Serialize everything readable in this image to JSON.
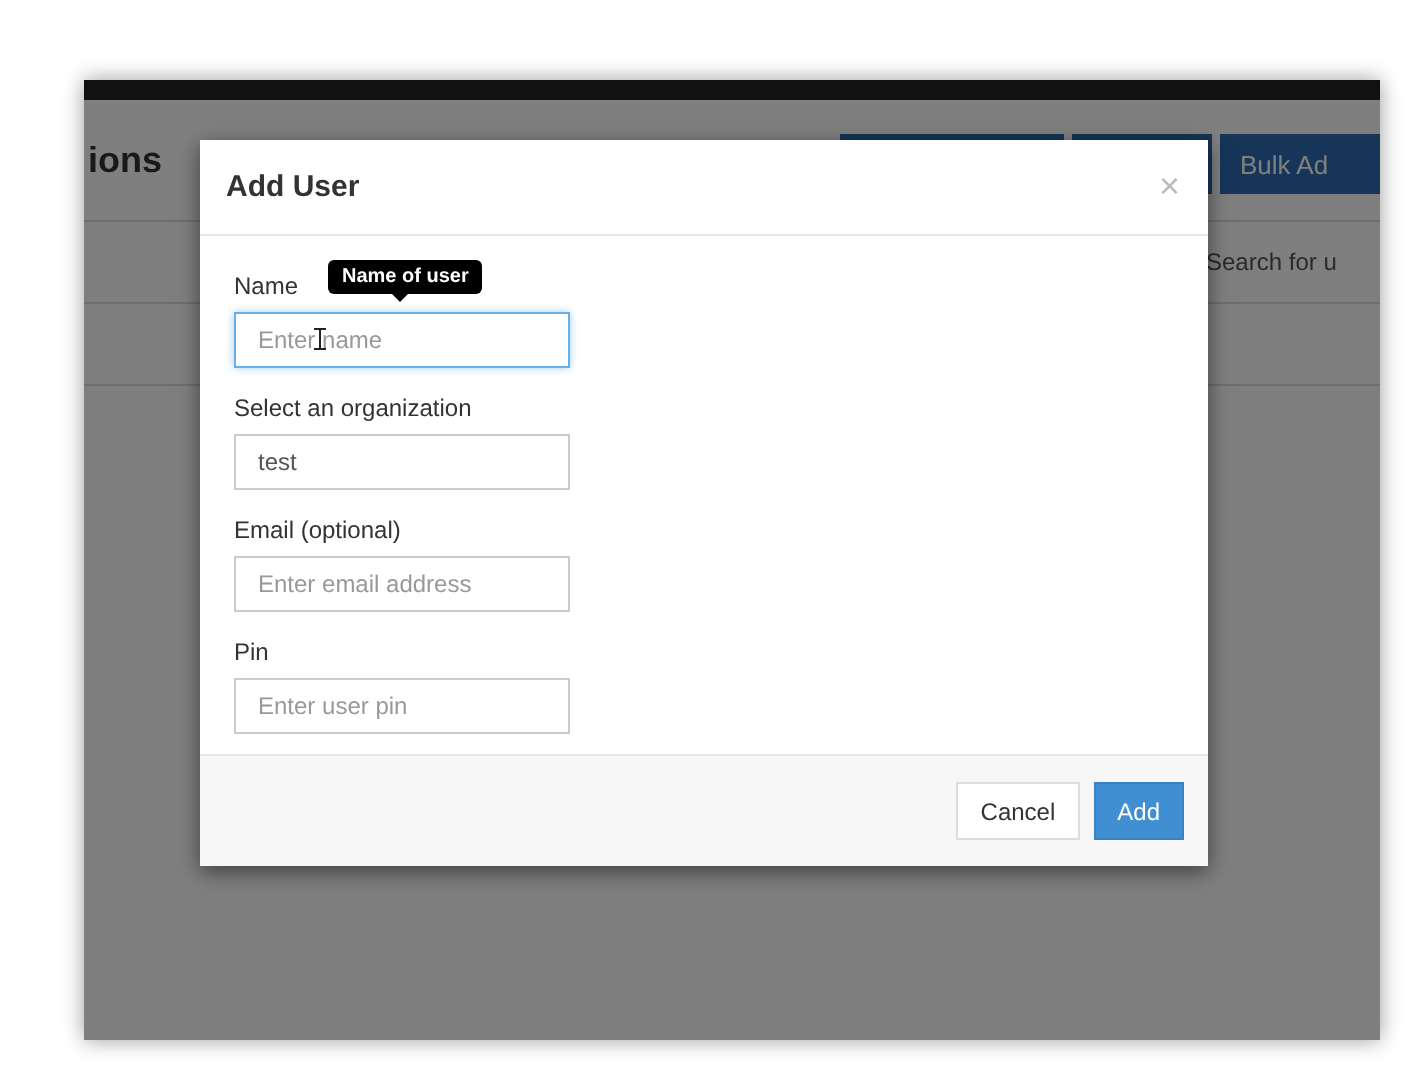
{
  "page": {
    "title": "ions",
    "header_buttons": [
      {
        "kind": "blank"
      },
      {
        "kind": "blank"
      },
      {
        "kind": "labeled",
        "label": "Bulk Ad"
      }
    ],
    "search": {
      "placeholder": "Search for u"
    }
  },
  "dialog": {
    "title": "Add User",
    "close": "×",
    "fields": [
      {
        "label": "Name",
        "placeholder": "Enter name",
        "focused": true,
        "tooltip": "Name of user"
      },
      {
        "label": "Select an organization",
        "value": "test",
        "focused": false
      },
      {
        "label": "Email (optional)",
        "placeholder": "Enter email address",
        "focused": false
      },
      {
        "label": "Pin",
        "placeholder": "Enter user pin",
        "focused": false
      }
    ],
    "buttons": [
      {
        "label": "Cancel",
        "kind": "default"
      },
      {
        "label": "Add",
        "kind": "primary"
      }
    ]
  }
}
